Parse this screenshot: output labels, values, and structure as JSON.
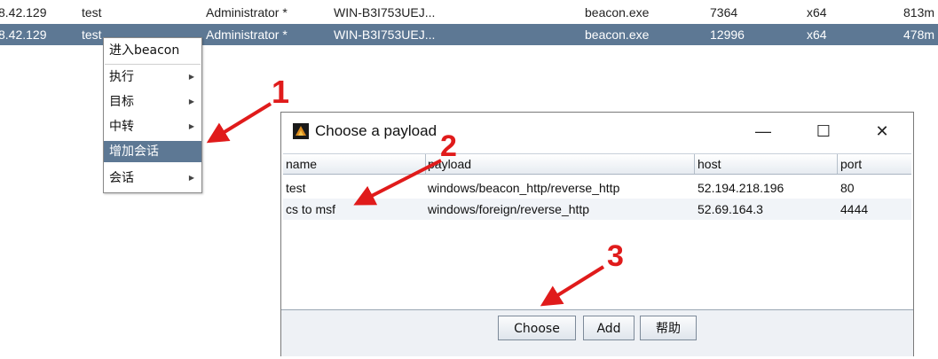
{
  "beacons": [
    {
      "ip": "8.42.129",
      "user": "test",
      "account": "Administrator *",
      "computer": "WIN-B3I753UEJ...",
      "process": "beacon.exe",
      "pid": "7364",
      "arch": "x64",
      "last": "813m"
    },
    {
      "ip": "8.42.129",
      "user": "test",
      "account": "Administrator *",
      "computer": "WIN-B3I753UEJ...",
      "process": "beacon.exe",
      "pid": "12996",
      "arch": "x64",
      "last": "478m"
    }
  ],
  "context_menu": {
    "items": [
      {
        "label": "进入beacon",
        "submenu": false
      },
      {
        "label": "执行",
        "submenu": true
      },
      {
        "label": "目标",
        "submenu": true
      },
      {
        "label": "中转",
        "submenu": true
      },
      {
        "label": "增加会话",
        "submenu": false,
        "highlighted": true
      },
      {
        "label": "会话",
        "submenu": true
      }
    ]
  },
  "dialog": {
    "title": "Choose a payload",
    "columns": {
      "name": "name",
      "payload": "payload",
      "host": "host",
      "port": "port"
    },
    "rows": [
      {
        "name": "test",
        "payload": "windows/beacon_http/reverse_http",
        "host": "52.194.218.196",
        "port": "80"
      },
      {
        "name": "cs to msf",
        "payload": "windows/foreign/reverse_http",
        "host": "52.69.164.3",
        "port": "4444"
      }
    ],
    "buttons": {
      "choose": "Choose",
      "add": "Add",
      "help": "帮助"
    },
    "window_controls": {
      "minimize": "—",
      "maximize": "☐",
      "close": "✕"
    }
  },
  "annotations": {
    "step1": "1",
    "step2": "2",
    "step3": "3",
    "color": "#e01b1b"
  },
  "colors": {
    "selection": "#5d7894"
  }
}
